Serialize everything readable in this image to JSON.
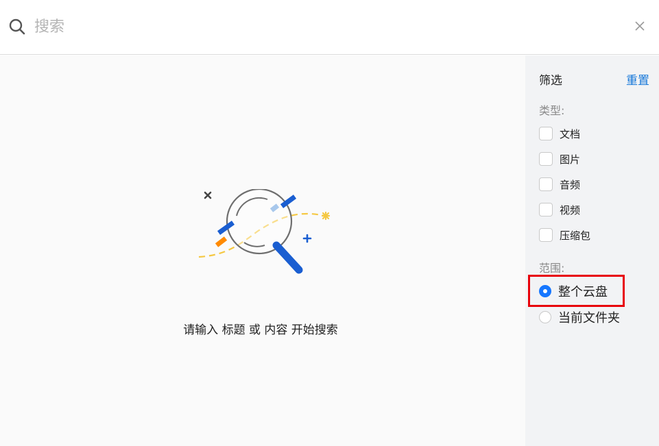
{
  "search": {
    "placeholder": "搜索"
  },
  "main": {
    "empty_message": "请输入 标题 或 内容 开始搜索"
  },
  "filter": {
    "title": "筛选",
    "reset_label": "重置",
    "type_label": "类型:",
    "types": [
      "文档",
      "图片",
      "音频",
      "视频",
      "压缩包"
    ],
    "scope_label": "范围:",
    "scopes": [
      {
        "label": "整个云盘",
        "selected": true
      },
      {
        "label": "当前文件夹",
        "selected": false
      }
    ]
  },
  "colors": {
    "accent": "#1677ff",
    "link": "#1677d9",
    "highlight": "#e8000b",
    "illustration_yellow": "#f5c842",
    "illustration_orange": "#ff8a00"
  }
}
